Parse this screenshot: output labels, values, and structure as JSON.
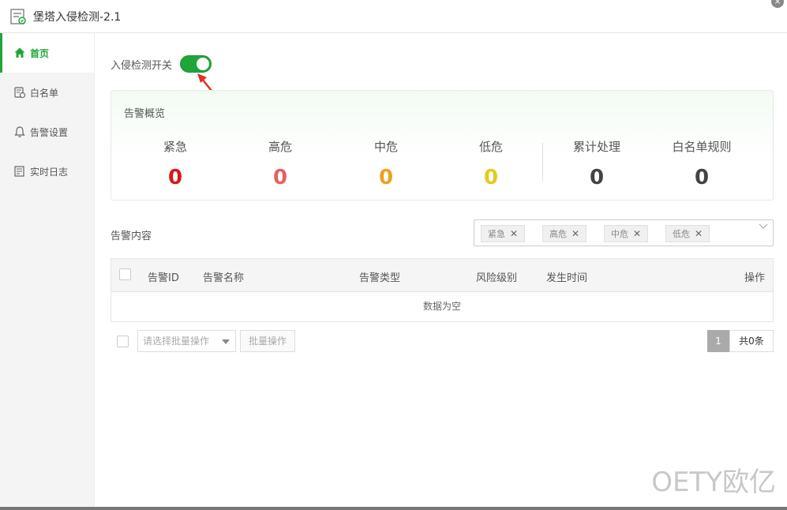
{
  "window": {
    "title": "堡塔入侵检测-2.1",
    "close_glyph": "×"
  },
  "sidebar": {
    "items": [
      {
        "label": "首页",
        "icon": "home-icon"
      },
      {
        "label": "白名单",
        "icon": "whitelist-icon"
      },
      {
        "label": "告警设置",
        "icon": "bell-icon"
      },
      {
        "label": "实时日志",
        "icon": "log-icon"
      }
    ]
  },
  "main": {
    "switch_label": "入侵检测开关",
    "switch_on": true,
    "overview": {
      "title": "告警概览",
      "stats": [
        {
          "label": "紧急",
          "value": "0",
          "color": "#d71818"
        },
        {
          "label": "高危",
          "value": "0",
          "color": "#e86060"
        },
        {
          "label": "中危",
          "value": "0",
          "color": "#f0a020"
        },
        {
          "label": "低危",
          "value": "0",
          "color": "#e3cb1b"
        },
        {
          "label": "累计处理",
          "value": "0",
          "color": "#444444"
        },
        {
          "label": "白名单规则",
          "value": "0",
          "color": "#444444"
        }
      ]
    },
    "content_title": "告警内容",
    "filter_tags": [
      "紧急",
      "高危",
      "中危",
      "低危"
    ],
    "tag_close_glyph": "✕",
    "table": {
      "columns": [
        "告警ID",
        "告警名称",
        "告警类型",
        "风险级别",
        "发生时间",
        "操作"
      ],
      "empty_text": "数据为空"
    },
    "footer": {
      "select_placeholder": "请选择批量操作",
      "batch_button": "批量操作",
      "page": "1",
      "total": "共0条"
    }
  },
  "watermark": "OETY欧亿",
  "colors": {
    "accent": "#20a53a"
  }
}
